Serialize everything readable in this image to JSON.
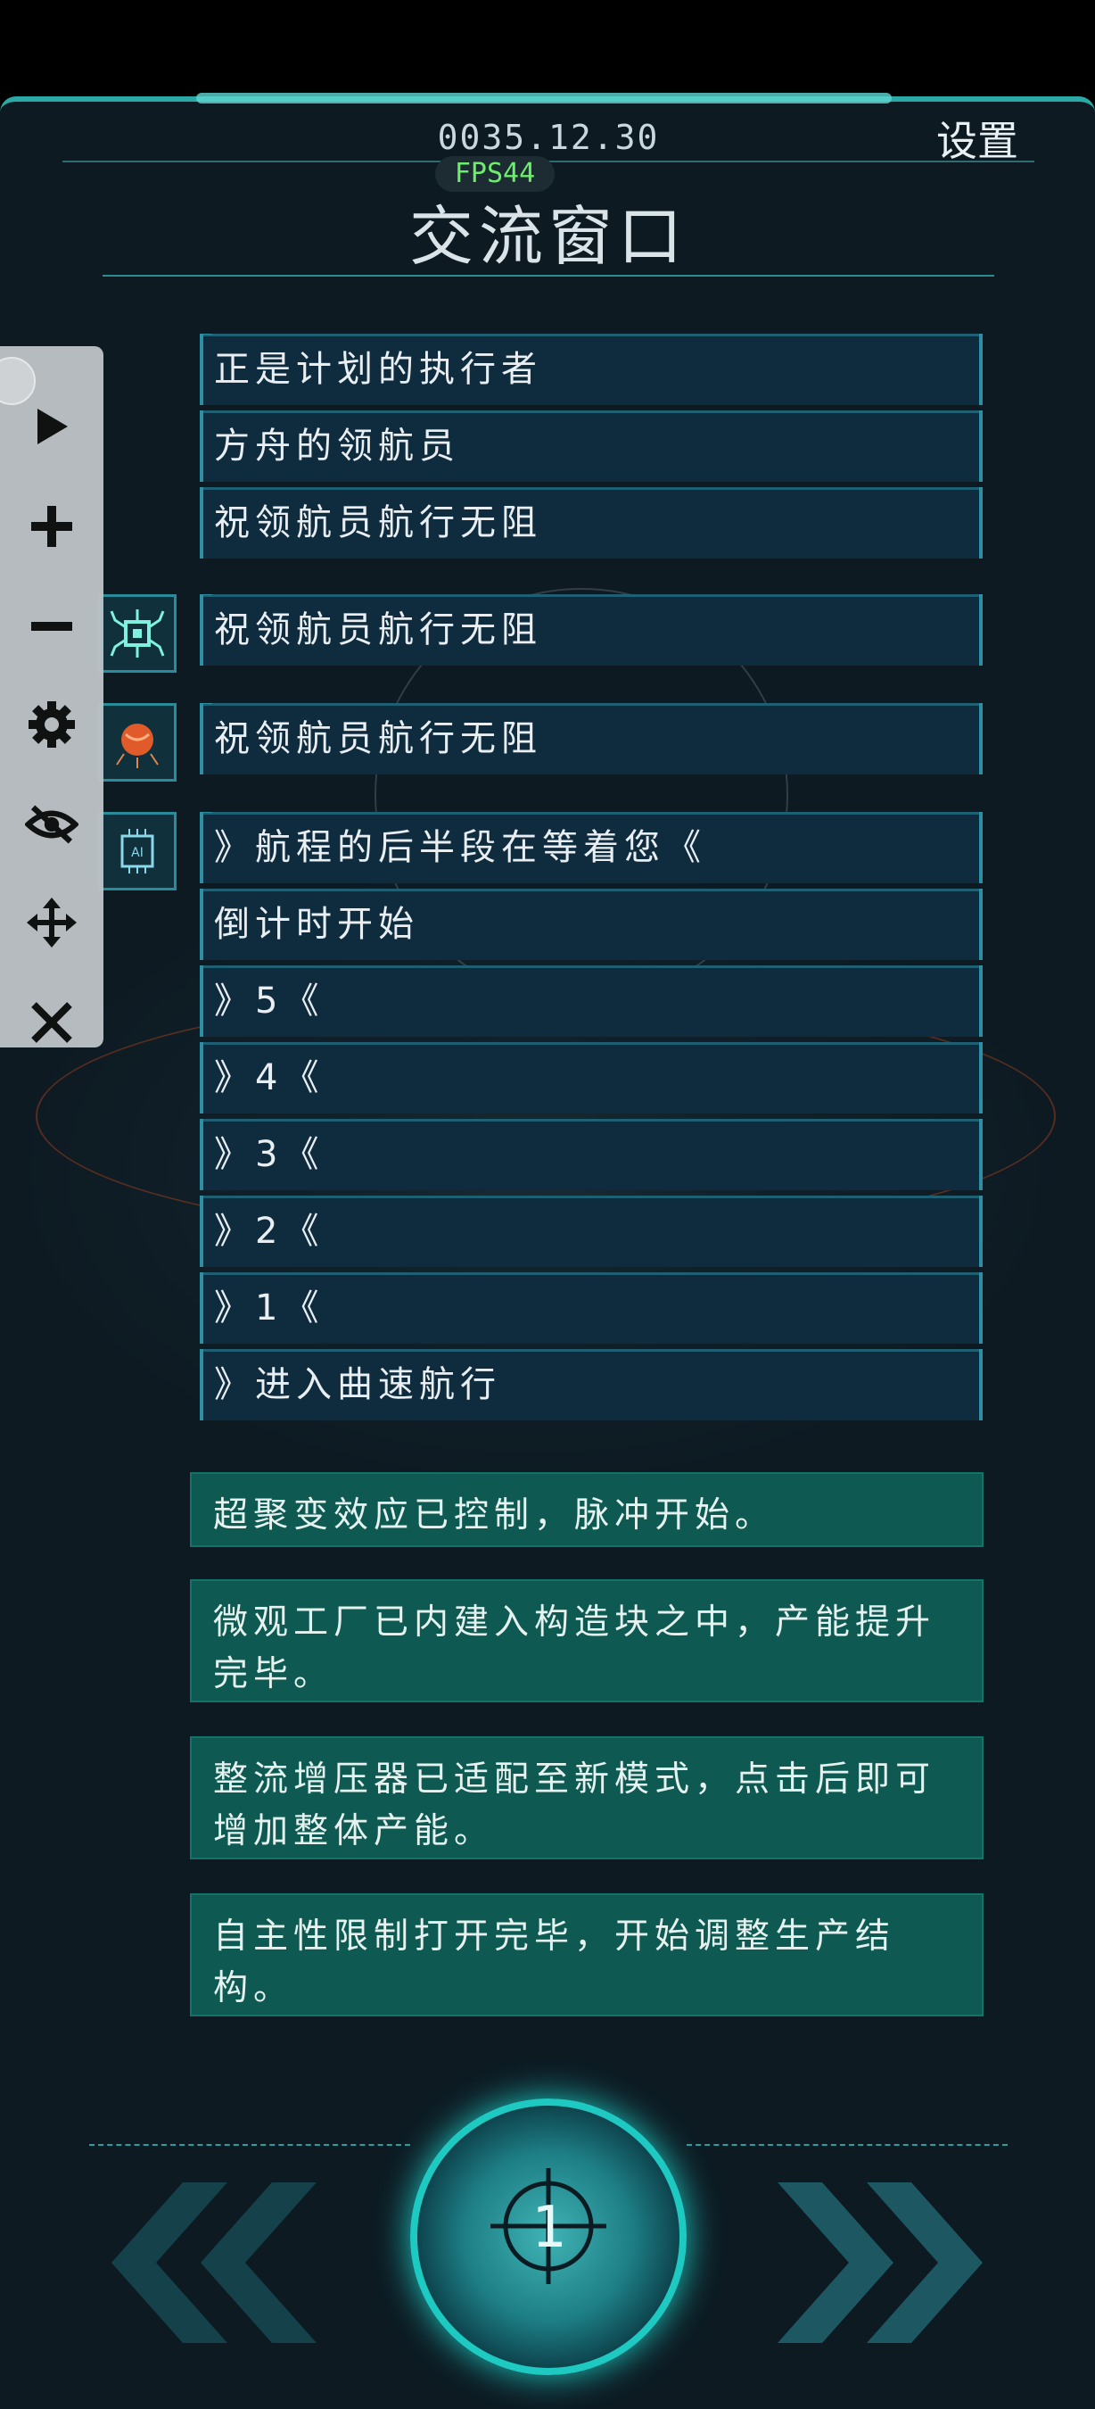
{
  "header": {
    "date": "0035.12.30",
    "fps": "FPS44",
    "settings_label": "设置",
    "title": "交流窗口"
  },
  "messages": [
    "正是计划的执行者",
    "方舟的领航员",
    "祝领航员航行无阻",
    "祝领航员航行无阻",
    "祝领航员航行无阻",
    "》航程的后半段在等着您《",
    "倒计时开始",
    "》5《",
    "》4《",
    "》3《",
    "》2《",
    "》1《",
    "》进入曲速航行"
  ],
  "avatars": [
    "chip-spider-icon",
    "orange-planet-icon",
    "ai-chip-icon"
  ],
  "notifications": [
    "超聚变效应已控制，脉冲开始。",
    "微观工厂已内建入构造块之中，产能提升完毕。",
    "整流增压器已适配至新模式，点击后即可增加整体产能。",
    "自主性限制打开完毕，开始调整生产结构。"
  ],
  "toolbar": [
    "play-icon",
    "plus-icon",
    "minus-icon",
    "gear-icon",
    "eye-off-icon",
    "move-icon",
    "close-icon"
  ],
  "bottom": {
    "center_number": "1"
  },
  "colors": {
    "accent": "#1ec9c2",
    "message_bg": "#0f2c3f",
    "notification_bg": "#0e5a52",
    "fps_text": "#6cf06c"
  }
}
